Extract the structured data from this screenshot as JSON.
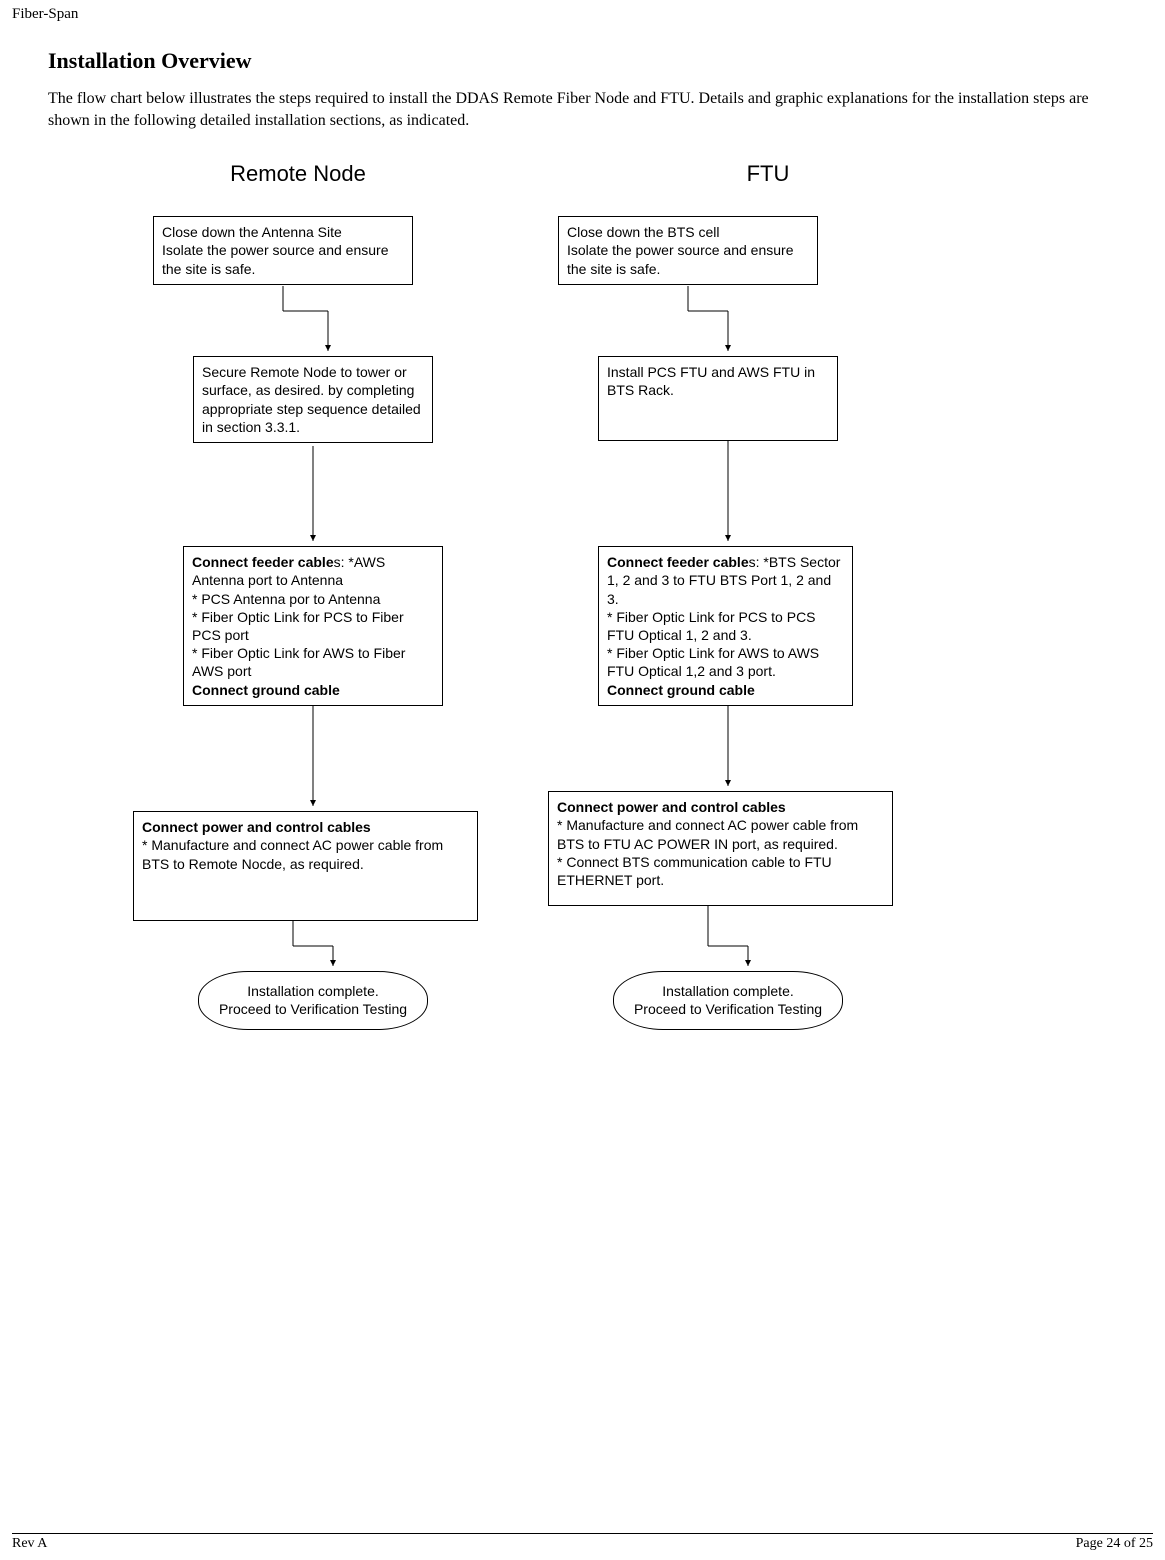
{
  "header": "Fiber-Span",
  "title": "Installation Overview",
  "intro": "The flow chart below illustrates the steps required to install the DDAS Remote Fiber Node and FTU.  Details and graphic explanations for the installation steps are shown in the following detailed installation sections, as indicated.",
  "columns": {
    "left": "Remote Node",
    "right": "FTU"
  },
  "left_boxes": {
    "b1": "Close down the Antenna Site\nIsolate the power source and ensure the site is safe.",
    "b2": "Secure Remote Node to tower or surface, as desired. by completing appropriate step sequence detailed in section 3.3.1.",
    "b3_title": "Connect feeder cable",
    "b3_s": "s:",
    "b3_body": " *AWS Antenna port to Antenna\n * PCS Antenna por to Antenna\n * Fiber Optic Link for PCS to Fiber PCS port\n * Fiber Optic Link for AWS to Fiber AWS port",
    "b3_ground": "Connect ground cable",
    "b4_title": "Connect power and control cables",
    "b4_body": "*  Manufacture and connect AC power cable from\n   BTS to Remote Nocde, as required.",
    "term": "Installation complete.\nProceed to Verification Testing"
  },
  "right_boxes": {
    "b1": "Close down the BTS cell\nIsolate the power source and ensure the site is safe.",
    "b2": "Install PCS FTU and AWS FTU in BTS Rack.",
    "b3_title": "Connect feeder cable",
    "b3_s": "s:",
    "b3_body": " *BTS Sector 1, 2 and 3 to FTU BTS Port 1, 2 and 3.\n * Fiber Optic Link for PCS to PCS FTU Optical 1, 2 and 3.\n * Fiber Optic Link for AWS to AWS FTU Optical 1,2 and 3 port.",
    "b3_ground": "Connect  ground cable",
    "b4_title": "Connect power and control cables",
    "b4_body": "*   Manufacture and connect AC power cable from\n    BTS to FTU AC POWER IN port, as required.\n * Connect BTS communication cable to FTU ETHERNET port.",
    "term": "Installation complete.\nProceed to Verification Testing"
  },
  "footer": {
    "left": "Rev A",
    "right": "Page 24 of 25"
  },
  "chart_data": {
    "type": "flowchart",
    "columns": [
      {
        "title": "Remote Node",
        "steps": [
          "Close down the Antenna Site. Isolate the power source and ensure the site is safe.",
          "Secure Remote Node to tower or surface, as desired, by completing appropriate step sequence detailed in section 3.3.1.",
          "Connect feeder cables: AWS Antenna port to Antenna; PCS Antenna port to Antenna; Fiber Optic Link for PCS to Fiber PCS port; Fiber Optic Link for AWS to Fiber AWS port. Connect ground cable.",
          "Connect power and control cables: Manufacture and connect AC power cable from BTS to Remote Node, as required.",
          "Installation complete. Proceed to Verification Testing"
        ]
      },
      {
        "title": "FTU",
        "steps": [
          "Close down the BTS cell. Isolate the power source and ensure the site is safe.",
          "Install PCS FTU and AWS FTU in BTS Rack.",
          "Connect feeder cables: BTS Sector 1, 2 and 3 to FTU BTS Port 1, 2 and 3; Fiber Optic Link for PCS to PCS FTU Optical 1, 2 and 3; Fiber Optic Link for AWS to AWS FTU Optical 1, 2 and 3 port. Connect ground cable.",
          "Connect power and control cables: Manufacture and connect AC power cable from BTS to FTU AC POWER IN port, as required. Connect BTS communication cable to FTU ETHERNET port.",
          "Installation complete. Proceed to Verification Testing"
        ]
      }
    ]
  }
}
